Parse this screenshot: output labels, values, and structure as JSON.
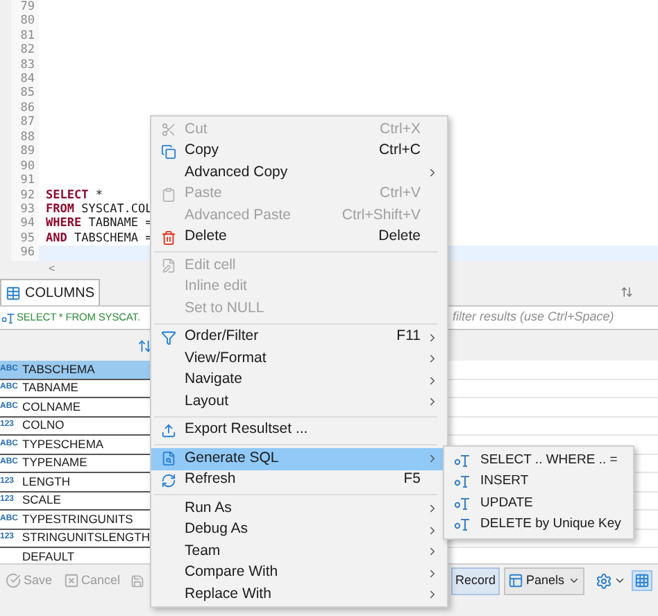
{
  "editor": {
    "lines": [
      {
        "number": "79"
      },
      {
        "number": "80"
      },
      {
        "number": "81"
      },
      {
        "number": "82"
      },
      {
        "number": "83"
      },
      {
        "number": "84"
      },
      {
        "number": "85"
      },
      {
        "number": "86"
      },
      {
        "number": "87"
      },
      {
        "number": "88"
      },
      {
        "number": "89"
      },
      {
        "number": "90"
      },
      {
        "number": "91"
      },
      {
        "number": "92",
        "tokens": [
          {
            "kind": "keyword",
            "text": "SELECT"
          },
          {
            "kind": "plain",
            "text": " *"
          }
        ]
      },
      {
        "number": "93",
        "tokens": [
          {
            "kind": "keyword",
            "text": "FROM"
          },
          {
            "kind": "plain",
            "text": " SYSCAT.COL"
          }
        ]
      },
      {
        "number": "94",
        "tokens": [
          {
            "kind": "keyword",
            "text": "WHERE"
          },
          {
            "kind": "plain",
            "text": " TABNAME ="
          }
        ]
      },
      {
        "number": "95",
        "tokens": [
          {
            "kind": "keyword",
            "text": "AND"
          },
          {
            "kind": "plain",
            "text": " TABSCHEMA ="
          }
        ]
      },
      {
        "number": "96",
        "current": true
      }
    ],
    "scroll_left": "<"
  },
  "results": {
    "tab": {
      "label": "COLUMNS",
      "selected": true
    },
    "query": "SELECT * FROM SYSCAT.",
    "filter_placeholder": "filter results (use Ctrl+Space)",
    "rows": [
      {
        "type": "ABC",
        "name": "TABSCHEMA",
        "selected": true
      },
      {
        "type": "ABC",
        "name": "TABNAME",
        "selected": false
      },
      {
        "type": "ABC",
        "name": "COLNAME",
        "selected": false
      },
      {
        "type": "123",
        "name": "COLNO",
        "selected": false
      },
      {
        "type": "ABC",
        "name": "TYPESCHEMA",
        "selected": false
      },
      {
        "type": "ABC",
        "name": "TYPENAME",
        "selected": false
      },
      {
        "type": "123",
        "name": "LENGTH",
        "selected": false
      },
      {
        "type": "123",
        "name": "SCALE",
        "selected": false
      },
      {
        "type": "ABC",
        "name": "TYPESTRINGUNITS",
        "selected": false
      },
      {
        "type": "123",
        "name": "STRINGUNITSLENGTH",
        "selected": false
      },
      {
        "name": "DEFAULT",
        "selected": false
      }
    ],
    "toolbar": {
      "save": "Save",
      "cancel": "Cancel",
      "record": "Record",
      "panels": "Panels"
    }
  },
  "context_menu": {
    "items": [
      {
        "kind": "item",
        "label": "Cut",
        "shortcut": "Ctrl+X",
        "disabled": true,
        "submenu": false,
        "selected": false
      },
      {
        "kind": "item",
        "label": "Copy",
        "shortcut": "Ctrl+C",
        "disabled": false,
        "submenu": false,
        "selected": false
      },
      {
        "kind": "item",
        "label": "Advanced Copy",
        "disabled": false,
        "submenu": true,
        "selected": false
      },
      {
        "kind": "item",
        "label": "Paste",
        "shortcut": "Ctrl+V",
        "disabled": true,
        "submenu": false,
        "selected": false
      },
      {
        "kind": "item",
        "label": "Advanced Paste",
        "shortcut": "Ctrl+Shift+V",
        "disabled": true,
        "submenu": false,
        "selected": false
      },
      {
        "kind": "item",
        "label": "Delete",
        "shortcut": "Delete",
        "disabled": false,
        "submenu": false,
        "selected": false
      },
      {
        "kind": "separator"
      },
      {
        "kind": "item",
        "label": "Edit cell",
        "disabled": true,
        "submenu": false,
        "selected": false
      },
      {
        "kind": "item",
        "label": "Inline edit",
        "disabled": true,
        "submenu": false,
        "selected": false
      },
      {
        "kind": "item",
        "label": "Set to NULL",
        "disabled": true,
        "submenu": false,
        "selected": false
      },
      {
        "kind": "separator"
      },
      {
        "kind": "item",
        "label": "Order/Filter",
        "shortcut": "F11",
        "disabled": false,
        "submenu": true,
        "selected": false
      },
      {
        "kind": "item",
        "label": "View/Format",
        "disabled": false,
        "submenu": true,
        "selected": false
      },
      {
        "kind": "item",
        "label": "Navigate",
        "disabled": false,
        "submenu": true,
        "selected": false
      },
      {
        "kind": "item",
        "label": "Layout",
        "disabled": false,
        "submenu": true,
        "selected": false
      },
      {
        "kind": "separator"
      },
      {
        "kind": "item",
        "label": "Export Resultset ...",
        "disabled": false,
        "submenu": false,
        "selected": false
      },
      {
        "kind": "separator"
      },
      {
        "kind": "item",
        "label": "Generate SQL",
        "disabled": false,
        "submenu": true,
        "selected": true
      },
      {
        "kind": "item",
        "label": "Refresh",
        "shortcut": "F5",
        "disabled": false,
        "submenu": false,
        "selected": false
      },
      {
        "kind": "separator"
      },
      {
        "kind": "item",
        "label": "Run As",
        "disabled": false,
        "submenu": true,
        "selected": false
      },
      {
        "kind": "item",
        "label": "Debug As",
        "disabled": false,
        "submenu": true,
        "selected": false
      },
      {
        "kind": "item",
        "label": "Team",
        "disabled": false,
        "submenu": true,
        "selected": false
      },
      {
        "kind": "item",
        "label": "Compare With",
        "disabled": false,
        "submenu": true,
        "selected": false
      },
      {
        "kind": "item",
        "label": "Replace With",
        "disabled": false,
        "submenu": true,
        "selected": false
      }
    ]
  },
  "submenu": {
    "items": [
      "SELECT .. WHERE .. =",
      "INSERT",
      "UPDATE",
      "DELETE by Unique Key"
    ]
  }
}
